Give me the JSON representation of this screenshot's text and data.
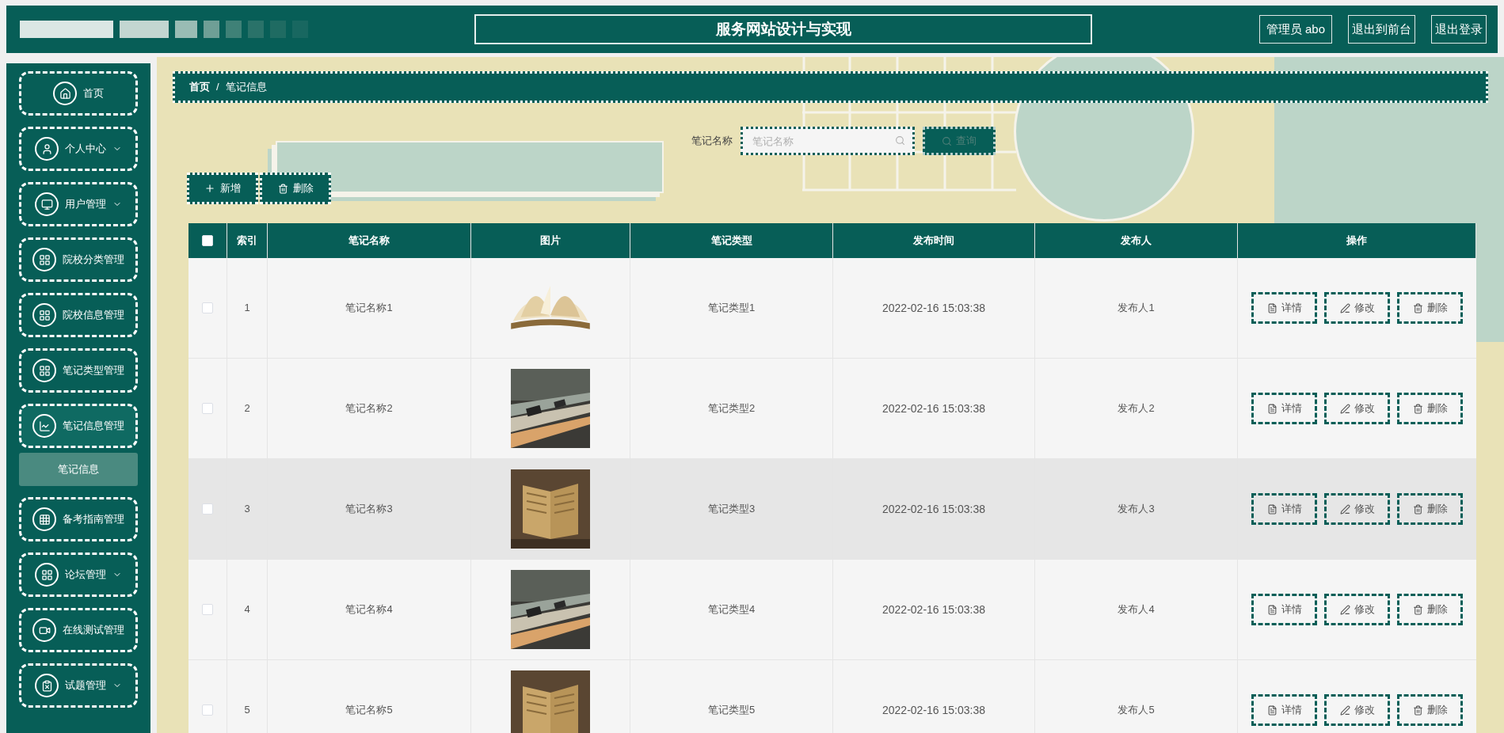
{
  "header": {
    "title": "服务网站设计与实现",
    "user": "管理员 abo",
    "links": [
      "退出到前台",
      "退出登录"
    ]
  },
  "sidebar": {
    "items": [
      {
        "label": "首页",
        "has_caret": false,
        "expanded": false
      },
      {
        "label": "个人中心",
        "has_caret": true,
        "expanded": false
      },
      {
        "label": "用户管理",
        "has_caret": true,
        "expanded": false
      },
      {
        "label": "院校分类管理",
        "has_caret": false,
        "expanded": false
      },
      {
        "label": "院校信息管理",
        "has_caret": false,
        "expanded": false
      },
      {
        "label": "笔记类型管理",
        "has_caret": false,
        "expanded": false
      },
      {
        "label": "笔记信息管理",
        "has_caret": false,
        "expanded": true,
        "children": [
          {
            "label": "笔记信息",
            "selected": true
          }
        ]
      },
      {
        "label": "备考指南管理",
        "has_caret": false,
        "expanded": false
      },
      {
        "label": "论坛管理",
        "has_caret": true,
        "expanded": false
      },
      {
        "label": "在线测试管理",
        "has_caret": false,
        "expanded": false
      },
      {
        "label": "试题管理",
        "has_caret": true,
        "expanded": false
      }
    ]
  },
  "breadcrumb": [
    "首页",
    "/",
    "笔记信息"
  ],
  "search": {
    "label": "笔记名称",
    "placeholder": "笔记名称",
    "button": "查询"
  },
  "toolbar": [
    "新增",
    "删除"
  ],
  "table": {
    "select_all_checked": false,
    "columns": [
      "索引",
      "笔记名称",
      "图片",
      "笔记类型",
      "发布时间",
      "发布人",
      "操作"
    ],
    "rows": [
      {
        "checked": false,
        "hovered": false,
        "index": "1",
        "name": "笔记名称1",
        "type": "笔记类型1",
        "time": "2022-02-16 15:03:38",
        "author": "发布人1",
        "actions": [
          "详情",
          "修改",
          "删除"
        ]
      },
      {
        "checked": false,
        "hovered": false,
        "index": "2",
        "name": "笔记名称2",
        "type": "笔记类型2",
        "time": "2022-02-16 15:03:38",
        "author": "发布人2",
        "actions": [
          "详情",
          "修改",
          "删除"
        ]
      },
      {
        "checked": false,
        "hovered": true,
        "index": "3",
        "name": "笔记名称3",
        "type": "笔记类型3",
        "time": "2022-02-16 15:03:38",
        "author": "发布人3",
        "actions": [
          "详情",
          "修改",
          "删除"
        ]
      },
      {
        "checked": false,
        "hovered": false,
        "index": "4",
        "name": "笔记名称4",
        "type": "笔记类型4",
        "time": "2022-02-16 15:03:38",
        "author": "发布人4",
        "actions": [
          "详情",
          "修改",
          "删除"
        ]
      },
      {
        "checked": false,
        "hovered": false,
        "index": "5",
        "name": "笔记名称5",
        "type": "笔记类型5",
        "time": "2022-02-16 15:03:38",
        "author": "发布人5",
        "actions": [
          "详情",
          "修改",
          "删除"
        ]
      }
    ]
  }
}
